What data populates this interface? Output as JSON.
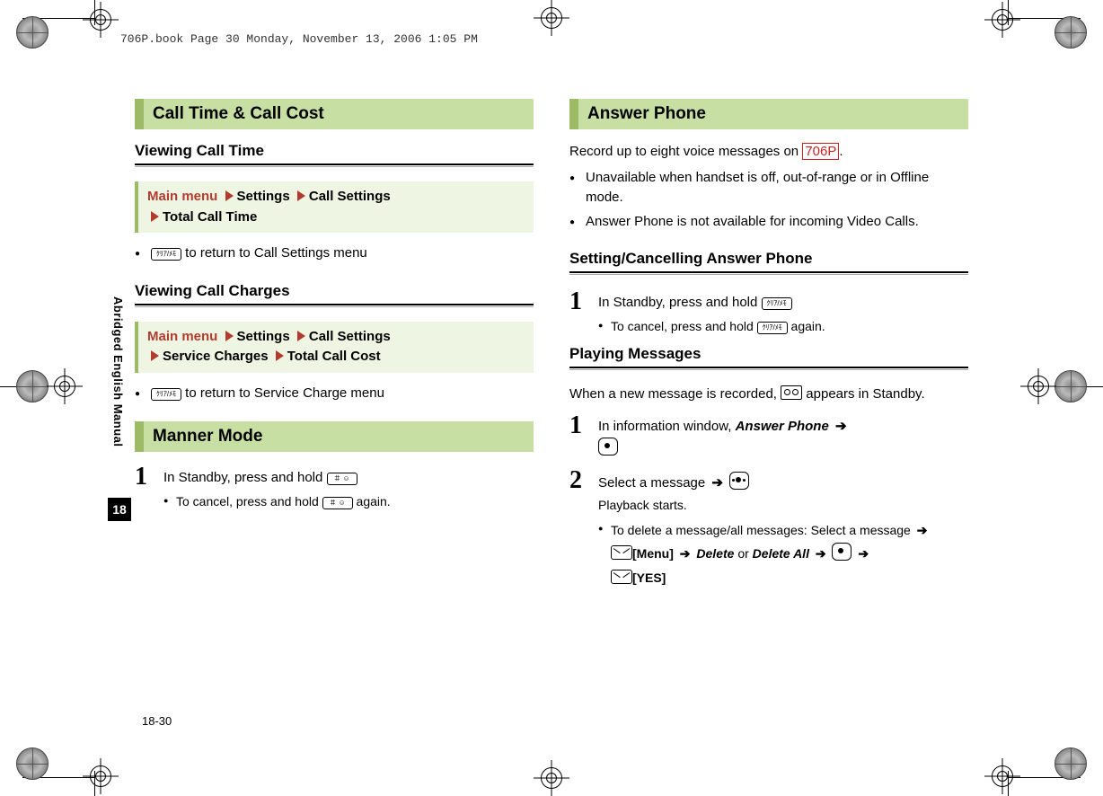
{
  "meta": {
    "header": "706P.book  Page 30  Monday, November 13, 2006  1:05 PM",
    "side_label": "Abridged English Manual",
    "chapter": "18",
    "page_num": "18-30"
  },
  "left": {
    "section1_title": "Call Time & Call Cost",
    "sub1": "Viewing Call Time",
    "menu1": {
      "prefix": "Main menu",
      "path": [
        "Settings",
        "Call Settings",
        "Total Call Time"
      ]
    },
    "bullet1": "to return to Call Settings menu",
    "sub2": "Viewing Call Charges",
    "menu2": {
      "prefix": "Main menu",
      "path": [
        "Settings",
        "Call Settings",
        "Service Charges",
        "Total Call Cost"
      ]
    },
    "bullet2": "to return to Service Charge menu",
    "section2_title": "Manner Mode",
    "step1": "In Standby, press and hold",
    "step1_sub": "To cancel, press and hold",
    "step1_sub_tail": "again."
  },
  "right": {
    "section_title": "Answer Phone",
    "intro_a": "Record up to eight voice messages on",
    "intro_red": "706P",
    "intro_b": ".",
    "bul1": "Unavailable when handset is off, out-of-range or in Offline mode.",
    "bul2": "Answer Phone is not available for incoming Video Calls.",
    "sub1": "Setting/Cancelling Answer Phone",
    "s1_step": "In Standby, press and hold",
    "s1_sub": "To cancel, press and hold",
    "s1_sub_tail": "again.",
    "sub2": "Playing Messages",
    "p_intro_a": "When a new message is recorded,",
    "p_intro_b": "appears in Standby.",
    "p_step1_a": "In information window,",
    "p_step1_b": "Answer Phone",
    "p_step2": "Select a message",
    "p_step2_note": "Playback starts.",
    "p_del_a": "To delete a message/all messages: Select a message",
    "p_del_menu": "[Menu]",
    "p_del_delete": "Delete",
    "p_del_or": "or",
    "p_del_deleteall": "Delete All",
    "p_del_yes": "[YES]"
  },
  "keys": {
    "clear": "ｸﾘｱ/ﾒﾓ",
    "hash": "＃ ☺"
  }
}
